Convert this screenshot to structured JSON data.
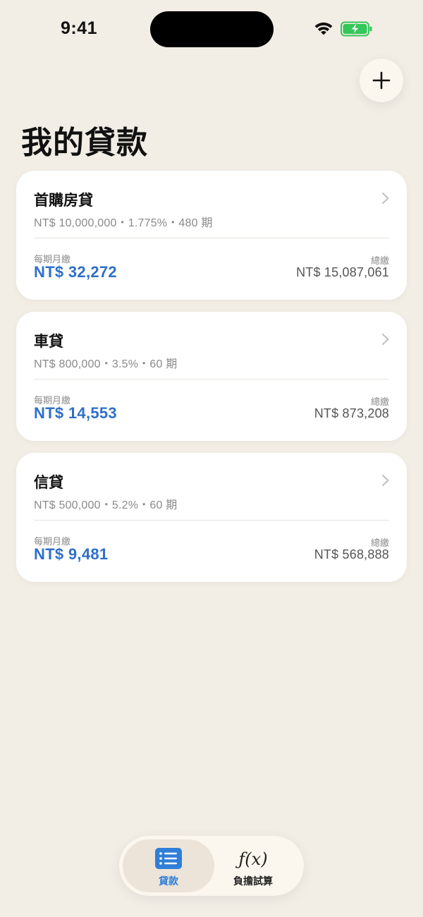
{
  "status": {
    "time": "9:41"
  },
  "header": {
    "title": "我的貸款",
    "add_icon": "plus-icon"
  },
  "loans": [
    {
      "name": "首購房貸",
      "summary": "NT$ 10,000,000・1.775%・480 期",
      "monthly_label": "每期月繳",
      "monthly_value": "NT$ 32,272",
      "total_label": "總繳",
      "total_value": "NT$ 15,087,061"
    },
    {
      "name": "車貸",
      "summary": "NT$ 800,000・3.5%・60 期",
      "monthly_label": "每期月繳",
      "monthly_value": "NT$ 14,553",
      "total_label": "總繳",
      "total_value": "NT$ 873,208"
    },
    {
      "name": "信貸",
      "summary": "NT$ 500,000・5.2%・60 期",
      "monthly_label": "每期月繳",
      "monthly_value": "NT$ 9,481",
      "total_label": "總繳",
      "total_value": "NT$ 568,888"
    }
  ],
  "tabs": [
    {
      "label": "貸款",
      "icon": "list-icon",
      "selected": true
    },
    {
      "label": "負擔試算",
      "icon": "function-icon",
      "glyph": "ƒ(x)",
      "selected": false
    }
  ],
  "colors": {
    "background": "#f2ede5",
    "accent": "#2f6fc9",
    "tab_accent": "#2f7fd9",
    "battery": "#34c759"
  }
}
